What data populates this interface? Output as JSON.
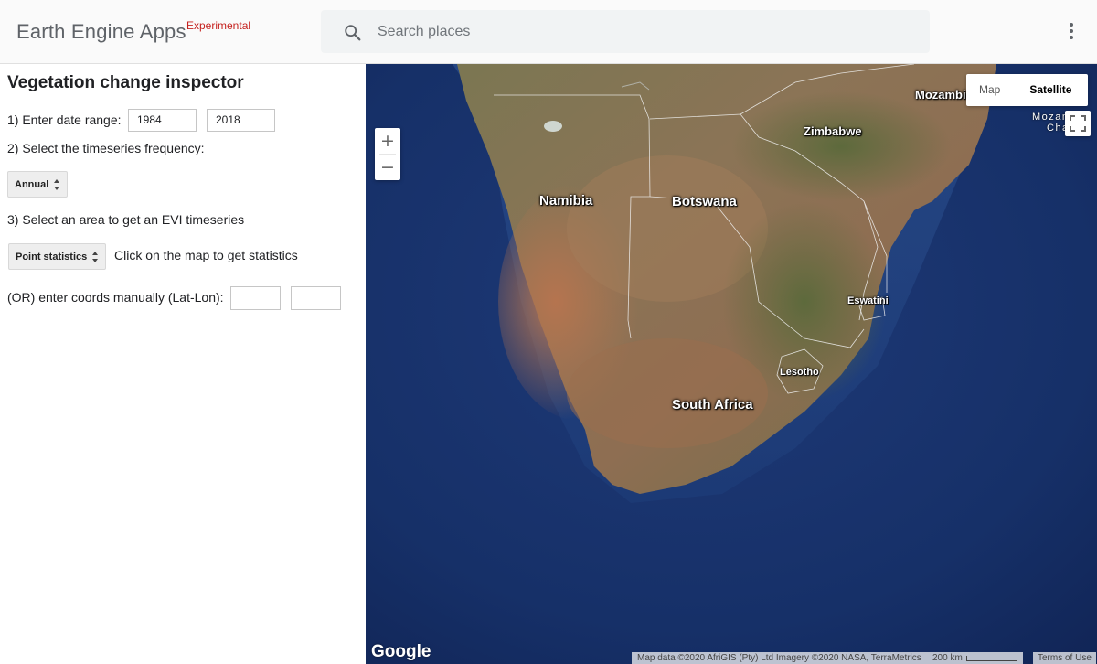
{
  "header": {
    "brand": "Earth Engine Apps",
    "badge": "Experimental",
    "search_placeholder": "Search places",
    "search_icon": "search-icon",
    "menu_icon": "more-vert-icon"
  },
  "panel": {
    "title": "Vegetation change inspector",
    "step1_label": "1) Enter date range:",
    "start_year": "1984",
    "end_year": "2018",
    "step2_label": "2) Select the timeseries frequency:",
    "frequency": "Annual",
    "step3_label": "3) Select an area to get an EVI timeseries",
    "area_mode": "Point statistics",
    "area_hint": "Click on the map to get statistics",
    "coords_label": "(OR) enter coords manually (Lat-Lon):",
    "lat": "",
    "lon": ""
  },
  "map": {
    "type_map": "Map",
    "type_satellite": "Satellite",
    "active_type": "Satellite",
    "zoom_in": "+",
    "zoom_out": "−",
    "labels": {
      "namibia": "Namibia",
      "botswana": "Botswana",
      "zimbabwe": "Zimbabwe",
      "south_africa": "South Africa",
      "eswatini": "Eswatini",
      "lesotho": "Lesotho",
      "mozambique": "Mozambiq",
      "moz_channel_1": "Mozambiq",
      "moz_channel_2": "Cha"
    },
    "google_logo": "Google",
    "attribution": "Map data ©2020 AfriGIS (Pty) Ltd Imagery ©2020 NASA, TerraMetrics",
    "scale": "200 km",
    "terms": "Terms of Use",
    "colors": {
      "ocean": "#14295a",
      "land": "#8a7656",
      "arid": "#a8704e"
    }
  }
}
